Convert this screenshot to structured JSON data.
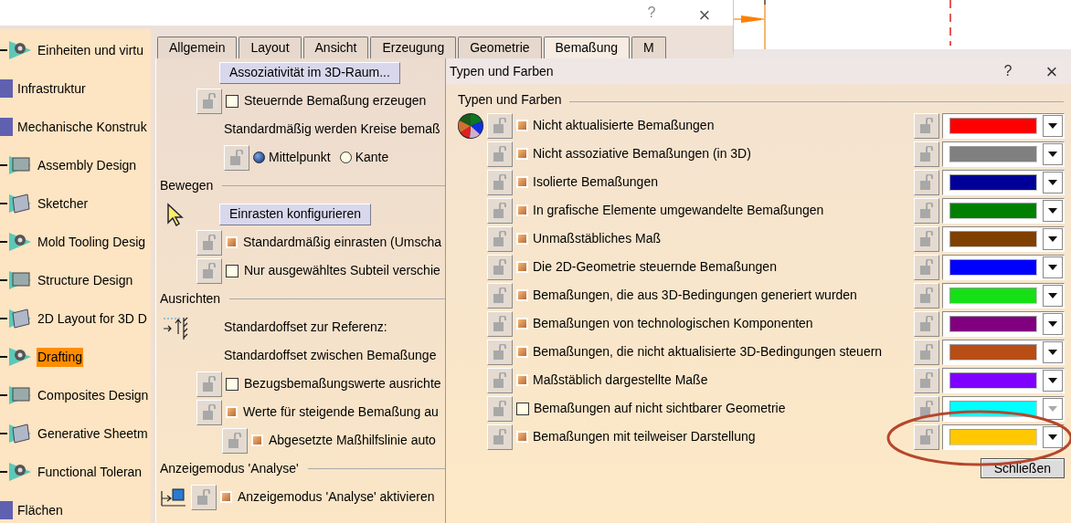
{
  "options_window": {
    "help": "?",
    "close": "×"
  },
  "sidebar": {
    "items": [
      {
        "label": "Einheiten und virtu",
        "kind": "workbench",
        "selected": false
      },
      {
        "label": "Infrastruktur",
        "kind": "category",
        "selected": false
      },
      {
        "label": "Mechanische Konstruk",
        "kind": "category",
        "selected": false,
        "children": [
          {
            "label": "Assembly Design",
            "kind": "workbench",
            "selected": false
          },
          {
            "label": "Sketcher",
            "kind": "workbench",
            "selected": false
          },
          {
            "label": "Mold Tooling Desig",
            "kind": "workbench",
            "selected": false
          },
          {
            "label": "Structure Design",
            "kind": "workbench",
            "selected": false
          },
          {
            "label": "2D Layout for 3D D",
            "kind": "workbench",
            "selected": false
          },
          {
            "label": "Drafting",
            "kind": "workbench",
            "selected": true
          },
          {
            "label": "Composites Design",
            "kind": "workbench",
            "selected": false
          },
          {
            "label": "Generative Sheetm",
            "kind": "workbench",
            "selected": false
          },
          {
            "label": "Functional Toleran",
            "kind": "workbench",
            "selected": false
          }
        ]
      },
      {
        "label": "Flächen",
        "kind": "category",
        "selected": false
      }
    ]
  },
  "tabs": [
    {
      "label": "Allgemein",
      "selected": false
    },
    {
      "label": "Layout",
      "selected": false
    },
    {
      "label": "Ansicht",
      "selected": false
    },
    {
      "label": "Erzeugung",
      "selected": false
    },
    {
      "label": "Geometrie",
      "selected": false
    },
    {
      "label": "Bemaßung",
      "selected": true
    },
    {
      "label": "M",
      "selected": false
    }
  ],
  "panel": {
    "rows": [
      {
        "kind": "button",
        "label": "Assoziativität im 3D-Raum..."
      },
      {
        "kind": "checkbox",
        "label": "Steuernde Bemaßung erzeugen",
        "checked": false
      },
      {
        "kind": "text",
        "label": "Standardmäßig werden Kreise bemaß"
      },
      {
        "kind": "radio",
        "options": [
          {
            "label": "Mittelpunkt",
            "selected": true
          },
          {
            "label": "Kante",
            "selected": false
          }
        ]
      },
      {
        "kind": "section",
        "label": "Bewegen"
      },
      {
        "kind": "button",
        "label": "Einrasten konfigurieren"
      },
      {
        "kind": "checkbox",
        "label": "Standardmäßig einrasten (Umscha",
        "checked": true
      },
      {
        "kind": "checkbox",
        "label": "Nur ausgewähltes Subteil verschie",
        "checked": false
      },
      {
        "kind": "section",
        "label": "Ausrichten"
      },
      {
        "kind": "text",
        "label": "Standardoffset zur Referenz:"
      },
      {
        "kind": "text",
        "label": "Standardoffset zwischen Bemaßunge"
      },
      {
        "kind": "checkbox",
        "label": "Bezugsbemaßungswerte ausrichte",
        "checked": false
      },
      {
        "kind": "checkbox",
        "label": "Werte für steigende Bemaßung au",
        "checked": true,
        "children": [
          {
            "kind": "checkbox",
            "label": "Abgesetzte Maßhilfslinie auto",
            "checked": true
          }
        ]
      },
      {
        "kind": "section",
        "label": "Anzeigemodus 'Analyse'"
      },
      {
        "kind": "checkbox",
        "label": "Anzeigemodus 'Analyse' aktivieren",
        "checked": true
      }
    ]
  },
  "dialog": {
    "title": "Typen und Farben",
    "help": "?",
    "close": "×",
    "group": "Typen und Farben",
    "rows": [
      {
        "label": "Nicht aktualisierte Bemaßungen",
        "checked": true,
        "color": "#ff0000",
        "disabled": false,
        "highlighted": false
      },
      {
        "label": "Nicht assoziative Bemaßungen (in 3D)",
        "checked": true,
        "color": "#808080",
        "disabled": false,
        "highlighted": false
      },
      {
        "label": "Isolierte Bemaßungen",
        "checked": true,
        "color": "#000099",
        "disabled": false,
        "highlighted": false
      },
      {
        "label": "In grafische Elemente umgewandelte Bemaßungen",
        "checked": true,
        "color": "#008000",
        "disabled": false,
        "highlighted": false
      },
      {
        "label": "Unmaßstäbliches Maß",
        "checked": true,
        "color": "#804000",
        "disabled": false,
        "highlighted": false
      },
      {
        "label": "Die 2D-Geometrie steuernde Bemaßungen",
        "checked": true,
        "color": "#0000ff",
        "disabled": false,
        "highlighted": false
      },
      {
        "label": "Bemaßungen, die aus 3D-Bedingungen generiert wurden",
        "checked": true,
        "color": "#15e015",
        "disabled": false,
        "highlighted": false
      },
      {
        "label": "Bemaßungen von technologischen Komponenten",
        "checked": true,
        "color": "#800080",
        "disabled": false,
        "highlighted": false
      },
      {
        "label": "Bemaßungen, die nicht aktualisierte 3D-Bedingungen steuern",
        "checked": true,
        "color": "#b84d16",
        "disabled": false,
        "highlighted": false
      },
      {
        "label": "Maßstäblich dargestellte Maße",
        "checked": true,
        "color": "#8000ff",
        "disabled": false,
        "highlighted": false
      },
      {
        "label": "Bemaßungen auf nicht sichtbarer Geometrie",
        "checked": false,
        "color": "#00ffff",
        "disabled": true,
        "highlighted": false
      },
      {
        "label": "Bemaßungen mit teilweiser Darstellung",
        "checked": true,
        "color": "#ffc800",
        "disabled": false,
        "highlighted": true
      }
    ],
    "close_button": "Schließen"
  }
}
